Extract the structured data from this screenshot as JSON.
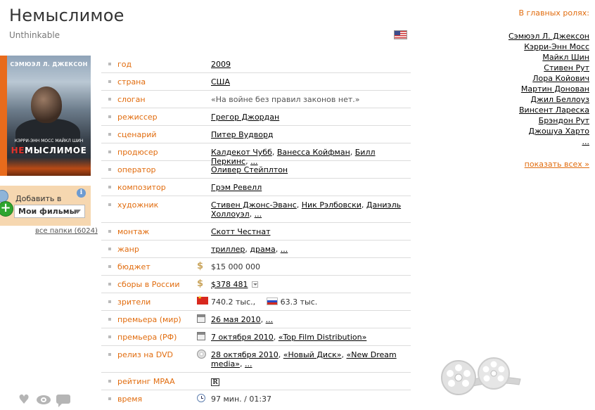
{
  "movie": {
    "title": "Немыслимое",
    "original_title": "Unthinkable",
    "flag_icon": "us-flag-icon"
  },
  "poster": {
    "actor": "СЭМЮЭЛ Л. ДЖЕКСОН",
    "co_stars": "КЭРРИ-ЭНН МОСС    МАЙКЛ ШИН",
    "title_em": "НЕ",
    "title_rest": "МЫСЛИМОЕ"
  },
  "add_to_folder": {
    "label": "Добавить в",
    "selected": "Мои фильмы",
    "info_glyph": "i",
    "all_folders": "все папки (6024)"
  },
  "info": {
    "year": {
      "label": "год",
      "value": "2009"
    },
    "country": {
      "label": "страна",
      "value": "США"
    },
    "tagline": {
      "label": "слоган",
      "value": "«На войне без правил законов нет.»"
    },
    "director": {
      "label": "режиссер",
      "value": "Грегор Джордан"
    },
    "writer": {
      "label": "сценарий",
      "value": "Питер Вудворд"
    },
    "producer": {
      "label": "продюсер",
      "values": [
        "Калдекот Чубб",
        "Ванесса Койфман",
        "Билл Перкинс",
        "..."
      ]
    },
    "operator": {
      "label": "оператор",
      "value": "Оливер Стейплтон"
    },
    "composer": {
      "label": "композитор",
      "value": "Грэм Ревелл"
    },
    "artist": {
      "label": "художник",
      "values": [
        "Стивен Джонс-Эванс",
        "Ник Рэлбовски",
        "Даниэль Холлоуэл",
        "..."
      ]
    },
    "editing": {
      "label": "монтаж",
      "value": "Скотт Честнат"
    },
    "genre": {
      "label": "жанр",
      "values": [
        "триллер",
        "драма",
        "..."
      ]
    },
    "budget": {
      "label": "бюджет",
      "value": "$15 000 000",
      "icon": "dollar-icon"
    },
    "box_office_ru": {
      "label": "сборы в России",
      "value": "$378 481",
      "icon": "dollar-icon"
    },
    "viewers": {
      "label": "зрители",
      "china": "740.2 тыс.,",
      "russia": "63.3 тыс."
    },
    "premiere_world": {
      "label": "премьера (мир)",
      "values": [
        "26 мая 2010",
        "..."
      ],
      "icon": "calendar-icon"
    },
    "premiere_ru": {
      "label": "премьера (РФ)",
      "values": [
        "7 октября 2010",
        "«Top Film Distribution»"
      ],
      "icon": "calendar-icon"
    },
    "dvd": {
      "label": "релиз на DVD",
      "values": [
        "28 октября 2010",
        "«Новый Диск»",
        "«New Dream media»",
        "..."
      ],
      "icon": "dvd-icon"
    },
    "mpaa": {
      "label": "рейтинг MPAA",
      "value": "R"
    },
    "runtime": {
      "label": "время",
      "value": "97 мин. / 01:37",
      "icon": "clock-icon"
    }
  },
  "cast": {
    "heading": "В главных ролях:",
    "actors": [
      "Сэмюэл Л. Джексон",
      "Кэрри-Энн Мосс",
      "Майкл Шин",
      "Стивен Рут",
      "Лора Койович",
      "Мартин Донован",
      "Джил Беллоуз",
      "Винсент Лареска",
      "Брэндон Рут",
      "Джошуа Харто",
      "..."
    ],
    "show_all": "показать всех »"
  },
  "colors": {
    "label_orange": "#e16c0e",
    "add_box_bg": "#f6d7b0",
    "poster_stripe": "#e86b1c"
  }
}
